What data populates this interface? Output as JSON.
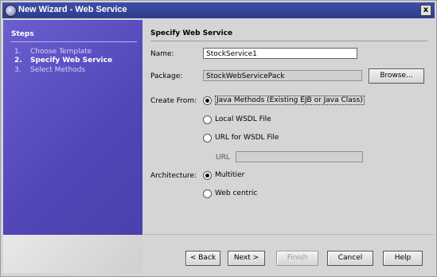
{
  "window": {
    "title": "New Wizard - Web Service",
    "close_label": "x"
  },
  "steps": {
    "title": "Steps",
    "items": [
      {
        "num": "1.",
        "label": "Choose Template"
      },
      {
        "num": "2.",
        "label": "Specify Web Service"
      },
      {
        "num": "3.",
        "label": "Select Methods"
      }
    ]
  },
  "panel": {
    "title": "Specify Web Service",
    "name_label": "Name:",
    "name_value": "StockService1",
    "package_label": "Package:",
    "package_value": "StockWebServicePack",
    "browse_label": "Browse...",
    "create_from_label": "Create From:",
    "create_from_options": [
      "Java Methods (Existing EJB or Java Class)",
      "Local WSDL File",
      "URL for WSDL File"
    ],
    "create_from_selected": "Java Methods (Existing EJB or Java Class)",
    "url_label": "URL",
    "url_value": "",
    "architecture_label": "Architecture:",
    "architecture_options": [
      "Multitier",
      "Web centric"
    ],
    "architecture_selected": "Multitier"
  },
  "buttons": {
    "back": "< Back",
    "next": "Next >",
    "finish": "Finish",
    "cancel": "Cancel",
    "help": "Help"
  }
}
